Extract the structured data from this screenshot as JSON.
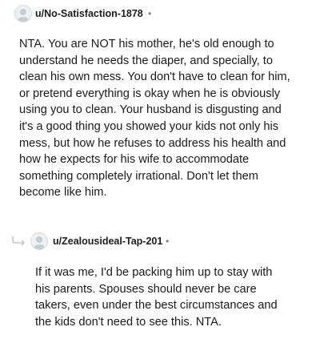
{
  "comments": [
    {
      "username": "u/No-Satisfaction-1878",
      "separator": "•",
      "lines": [
        "NTA. You are NOT his mother, he's old enough to",
        "understand he needs the diaper, and specially, to",
        "clean his own mess. You don't have to clean for him,",
        "or pretend everything is okay when he is obviously",
        "using you to clean. Your husband is disgusting and",
        "it's a good thing you showed your kids not only his",
        "mess, but how he refuses to address his health and",
        "how he expects for his wife to accommodate",
        "something completely irrational. Don't let them",
        "become like him."
      ]
    },
    {
      "username": "u/Zealousideal-Tap-201",
      "separator": "•",
      "lines": [
        "If it was me, I'd be packing him up to stay with",
        "his parents. Spouses should never be care",
        "takers, even under the best circumstances and",
        "the kids don't need to see this. NTA."
      ]
    }
  ],
  "icons": {
    "avatar": "default-avatar-icon",
    "reply_thread": "reply-arrow-icon"
  },
  "colors": {
    "text": "#1a1a1b",
    "meta": "#7c7c7c",
    "avatar_bg": "#eef0f2"
  }
}
